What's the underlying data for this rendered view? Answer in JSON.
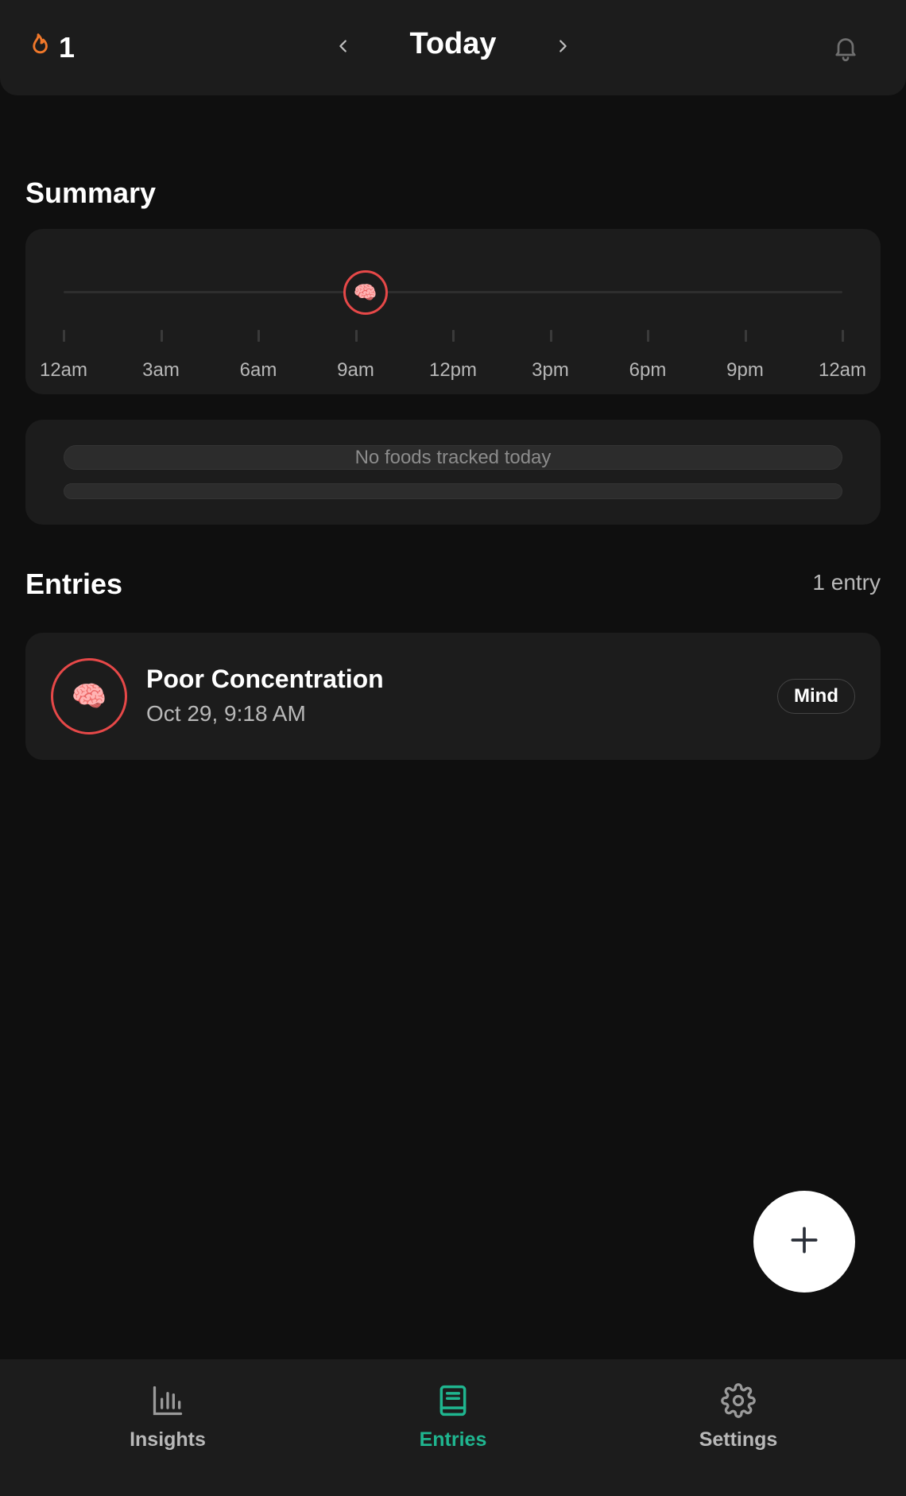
{
  "header": {
    "streak_count": "1",
    "title": "Today",
    "icons": [
      "flame-icon",
      "chevron-left-icon",
      "chevron-right-icon",
      "bell-icon"
    ]
  },
  "summary": {
    "title": "Summary",
    "timeline": {
      "tick_labels": [
        "12am",
        "3am",
        "6am",
        "9am",
        "12pm",
        "3pm",
        "6pm",
        "9pm",
        "12am"
      ],
      "marker": {
        "time": "9:18 AM",
        "hours": 9.3,
        "icon": "🧠"
      }
    },
    "foods_empty_text": "No foods tracked today"
  },
  "entries": {
    "title": "Entries",
    "count_label": "1 entry",
    "items": [
      {
        "icon": "🧠",
        "title": "Poor Concentration",
        "time": "Oct 29, 9:18 AM",
        "category": "Mind"
      }
    ]
  },
  "fab": {
    "icon": "plus-icon"
  },
  "bottom_nav": {
    "items": [
      {
        "label": "Insights",
        "icon": "bar-chart-icon",
        "active": false
      },
      {
        "label": "Entries",
        "icon": "book-icon",
        "active": true
      },
      {
        "label": "Settings",
        "icon": "gear-icon",
        "active": false
      }
    ]
  },
  "colors": {
    "background": "#0f0f0f",
    "surface": "#1c1c1c",
    "accent": "#1fb58f",
    "marker": "#e64848",
    "streak": "#f0782a",
    "muted_text": "#b8b8b8"
  }
}
